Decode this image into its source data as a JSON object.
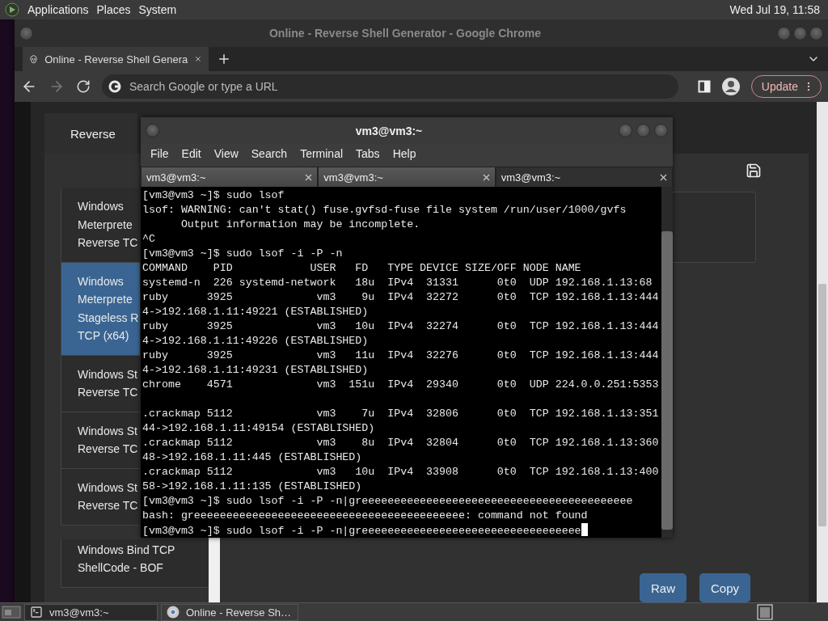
{
  "top_panel": {
    "menus": [
      "Applications",
      "Places",
      "System"
    ],
    "clock": "Wed Jul 19, 11:58"
  },
  "browser": {
    "title": "Online - Reverse Shell Generator - Google Chrome",
    "tabs": [
      {
        "title": "Online - Reverse Shell Genera",
        "selected": true
      }
    ],
    "forward_disabled": true,
    "address_placeholder": "Search Google or type a URL",
    "update_button": "Update",
    "page": {
      "section_tab": "Reverse",
      "list": [
        {
          "label": "Windows\nMeterprete\nReverse TC",
          "selected": false
        },
        {
          "label": "Windows\nMeterprete\nStageless R\nTCP (x64)",
          "selected": true
        },
        {
          "label": "Windows St\nReverse TC",
          "selected": false
        },
        {
          "label": "Windows St\nReverse TC",
          "selected": false
        },
        {
          "label": "Windows St\nReverse TC",
          "selected": false
        },
        {
          "label": "Windows Bind TCP\nShellCode - BOF",
          "selected": false
        }
      ],
      "buttons": [
        "Raw",
        "Copy"
      ]
    }
  },
  "terminal": {
    "title": "vm3@vm3:~",
    "menus": [
      "File",
      "Edit",
      "View",
      "Search",
      "Terminal",
      "Tabs",
      "Help"
    ],
    "tabs": [
      {
        "label": "vm3@vm3:~",
        "selected": false
      },
      {
        "label": "vm3@vm3:~",
        "selected": false
      },
      {
        "label": "vm3@vm3:~",
        "selected": true
      }
    ],
    "lines": [
      {
        "text": "[vm3@vm3 ~]$ sudo lsof"
      },
      {
        "text": "lsof: WARNING: can't stat() fuse.gvfsd-fuse file system /run/user/1000/gvfs"
      },
      {
        "text": "      Output information may be incomplete."
      },
      {
        "text": "^C"
      },
      {
        "text": "[vm3@vm3 ~]$ sudo lsof -i -P -n"
      },
      {
        "text": "COMMAND    PID            USER   FD   TYPE DEVICE SIZE/OFF NODE NAME"
      },
      {
        "text": "systemd-n  226 systemd-network   18u  IPv4  31331      0t0  UDP 192.168.1.13:68"
      },
      {
        "text": "ruby      3925             vm3    9u  IPv4  32272      0t0  TCP 192.168.1.13:444"
      },
      {
        "text": "4->192.168.1.11:49221 (ESTABLISHED)"
      },
      {
        "text": "ruby      3925             vm3   10u  IPv4  32274      0t0  TCP 192.168.1.13:444"
      },
      {
        "text": "4->192.168.1.11:49226 (ESTABLISHED)"
      },
      {
        "text": "ruby      3925             vm3   11u  IPv4  32276      0t0  TCP 192.168.1.13:444"
      },
      {
        "text": "4->192.168.1.11:49231 (ESTABLISHED)"
      },
      {
        "text": "chrome    4571             vm3  151u  IPv4  29340      0t0  UDP 224.0.0.251:5353",
        "wrap_blank": true
      },
      {
        "text": ".crackmap 5112             vm3    7u  IPv4  32806      0t0  TCP 192.168.1.13:351"
      },
      {
        "text": "44->192.168.1.11:49154 (ESTABLISHED)"
      },
      {
        "text": ".crackmap 5112             vm3    8u  IPv4  32804      0t0  TCP 192.168.1.13:360"
      },
      {
        "text": "48->192.168.1.11:445 (ESTABLISHED)"
      },
      {
        "text": ".crackmap 5112             vm3   10u  IPv4  33908      0t0  TCP 192.168.1.13:400"
      },
      {
        "text": "58->192.168.1.11:135 (ESTABLISHED)"
      },
      {
        "text": "[vm3@vm3 ~]$ sudo lsof -i -P -n|greeeeeeeeeeeeeeeeeeeeeeeeeeeeeeeeeeeeeeeeee"
      },
      {
        "text": "bash: greeeeeeeeeeeeeeeeeeeeeeeeeeeeeeeeeeeeeeeeee: command not found"
      },
      {
        "text": "[vm3@vm3 ~]$ sudo lsof -i -P -n|greeeeeeeeeeeeeeeeeeeeeeeeeeeeeeeeee",
        "cursor": true
      }
    ]
  },
  "taskbar": {
    "tasks": [
      {
        "label": "vm3@vm3:~",
        "kind": "terminal"
      },
      {
        "label": "Online - Reverse Sh…",
        "kind": "browser"
      }
    ]
  }
}
